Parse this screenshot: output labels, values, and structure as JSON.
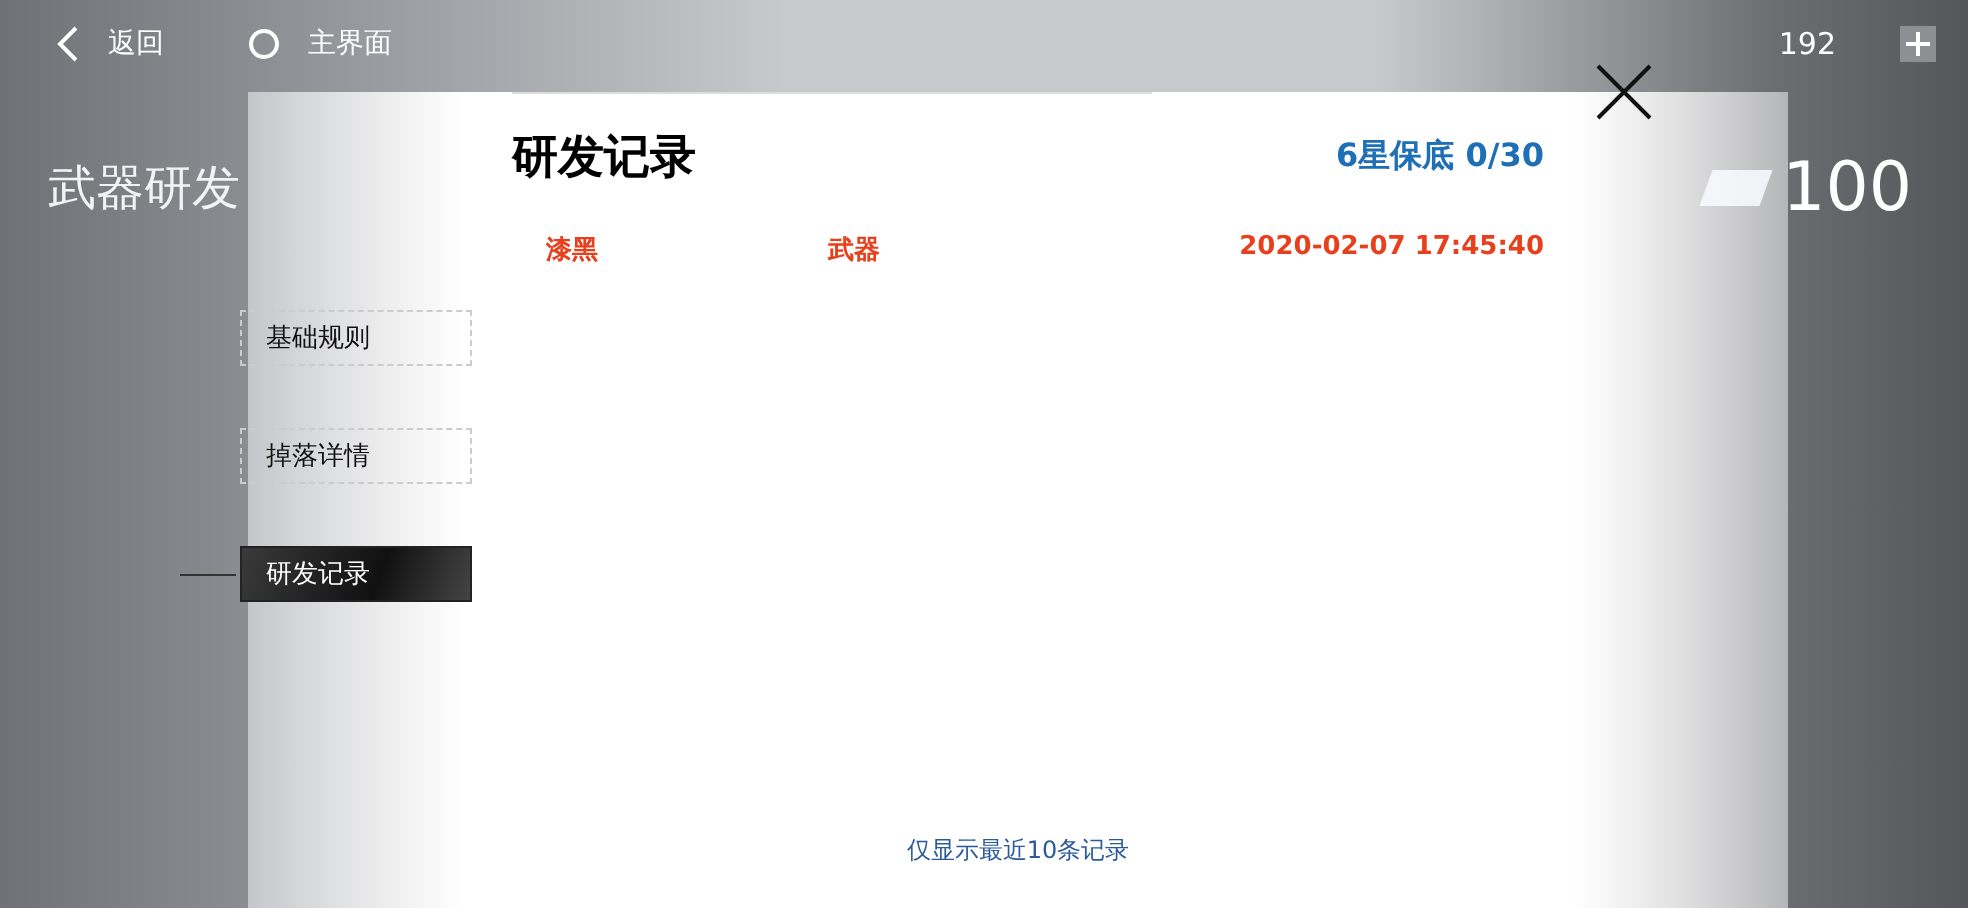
{
  "top_bar": {
    "back_label": "返回",
    "home_label": "主界面",
    "currency": "192"
  },
  "background": {
    "title": "武器研发",
    "tickets": "100"
  },
  "dialog": {
    "title": "研发记录",
    "pity": "6星保底 0/30",
    "tabs": [
      {
        "label": "基础规则",
        "selected": false
      },
      {
        "label": "掉落详情",
        "selected": false
      },
      {
        "label": "研发记录",
        "selected": true
      }
    ],
    "records": [
      {
        "name": "漆黑",
        "type": "武器",
        "time": "2020-02-07 17:45:40"
      }
    ],
    "note": "仅显示最近10条记录"
  }
}
